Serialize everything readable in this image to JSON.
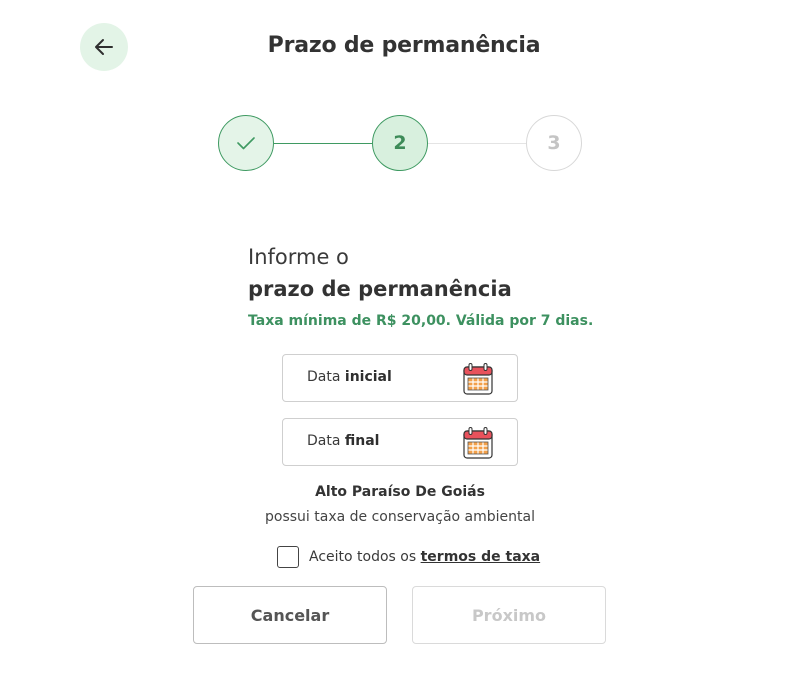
{
  "header": {
    "title": "Prazo de permanência",
    "back_icon": "arrow-left-icon"
  },
  "stepper": {
    "steps": [
      {
        "label": "",
        "state": "done",
        "icon": "check-icon"
      },
      {
        "label": "2",
        "state": "current"
      },
      {
        "label": "3",
        "state": "pending"
      }
    ]
  },
  "form": {
    "heading_line1": "Informe o",
    "heading_line2": "prazo de permanência",
    "fee_note": "Taxa mínima de R$ 20,00. Válida por 7 dias.",
    "start_date": {
      "prefix": "Data ",
      "emphasis": "inicial",
      "icon": "calendar-icon"
    },
    "end_date": {
      "prefix": "Data ",
      "emphasis": "final",
      "icon": "calendar-icon"
    }
  },
  "location": {
    "name": "Alto Paraíso De Goiás",
    "note": "possui taxa de conservação ambiental"
  },
  "terms": {
    "checked": false,
    "text": "Aceito todos os ",
    "link": "termos de taxa"
  },
  "actions": {
    "cancel_label": "Cancelar",
    "next_label": "Próximo"
  },
  "colors": {
    "accent": "#3f9a62",
    "accent_light": "#e3f4e7",
    "disabled_text": "#c8c8c8"
  }
}
